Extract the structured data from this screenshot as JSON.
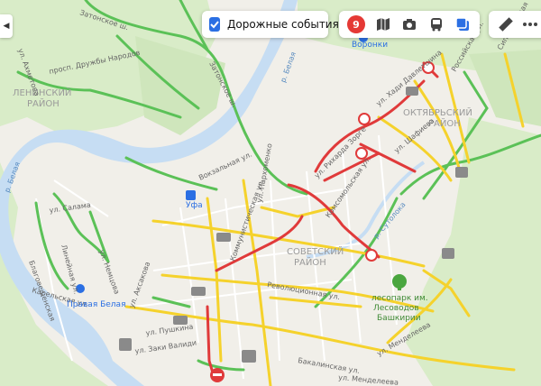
{
  "colors": {
    "green": "#5bc157",
    "yellow": "#f5d22c",
    "red": "#e03a3a",
    "water": "#c6ddf3",
    "park": "#d9ecc8",
    "land": "#f1efe9",
    "accent": "#2b6fe3"
  },
  "toolbar": {
    "traffic_events_label": "Дорожные события",
    "traffic_events_checked": true,
    "traffic_score": "9",
    "icons": [
      "traffic-score-icon",
      "panorama-icon",
      "camera-icon",
      "transit-bus-icon",
      "layers-icon"
    ],
    "tools": [
      "ruler-icon",
      "more-icon"
    ]
  },
  "map": {
    "labels": {
      "zatonskoe_sh": "Затонское ш.",
      "voronki": "Воронки",
      "belaya_top": "р. Белая",
      "lenin_1": "ЛЕНИНСКИЙ",
      "lenin_2": "РАЙОН",
      "druzhby": "просп. Дружбы Народов",
      "akhmetova": "ул. Ахметова",
      "zatonskoe_sh_2": "Затонское ш.",
      "oktyabr_1": "ОКТЯБРЬСКИЙ",
      "oktyabr_2": "РАЙОН",
      "sipaylovskaya": "Сипайловская",
      "rossiyskaya": "Российская ул.",
      "khadi": "ул. Хади Давлетшина",
      "zorge": "ул. Рихарда Зорге",
      "shafieva": "ул. Шафиева",
      "belaya_left": "р. Белая",
      "ufa": "Уфа",
      "vokzalnaya": "Вокзальная ул.",
      "salyama": "ул. Салама",
      "lineynaya": "Линейная ул.",
      "nemcha": "ул. Немцова",
      "blagoveschenskaya": "Благовещенская",
      "karelskaya": "Карельская ул.",
      "pravaya_belaya": "Правая Белая",
      "sovet_1": "СОВЕТСКИЙ",
      "sovet_2": "РАЙОН",
      "parkhomenko": "ул. Пархоменко",
      "revolyutsionnaya": "Революционная ул.",
      "kommunisticheskaya": "Коммунистическая ул.",
      "komsomolskaya": "Комсомольская ул.",
      "sutolok": "р. Сутолока",
      "aksakova": "ул. Аксакова",
      "pushkina": "ул. Пушкина",
      "zaki_validi": "ул. Заки Валиди",
      "bakaluzinskaya": "Бакалинская ул.",
      "mendeleeva": "ул. Менделеева",
      "mendeleeva_2": "ул. Менделеева",
      "park_1": "лесопарк им.",
      "park_2": "Лесоводов",
      "park_3": "Башкирии"
    }
  }
}
